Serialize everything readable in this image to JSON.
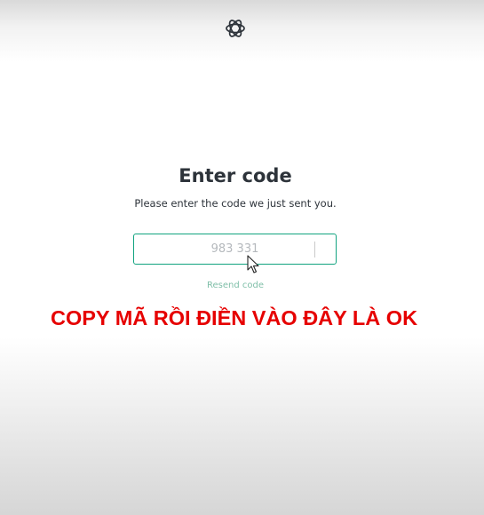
{
  "header": {
    "logo_icon": "openai-logo-icon"
  },
  "main": {
    "title": "Enter code",
    "subtitle": "Please enter the code we just sent you.",
    "code_input": {
      "placeholder": "983 331",
      "value": ""
    },
    "resend_link": "Resend code"
  },
  "overlay": {
    "caption": "COPY MÃ RỒI ĐIỀN VÀO ĐÂY LÀ OK"
  },
  "colors": {
    "accent": "#10a37f",
    "title_text": "#2d333a",
    "overlay_text": "#e60000"
  }
}
